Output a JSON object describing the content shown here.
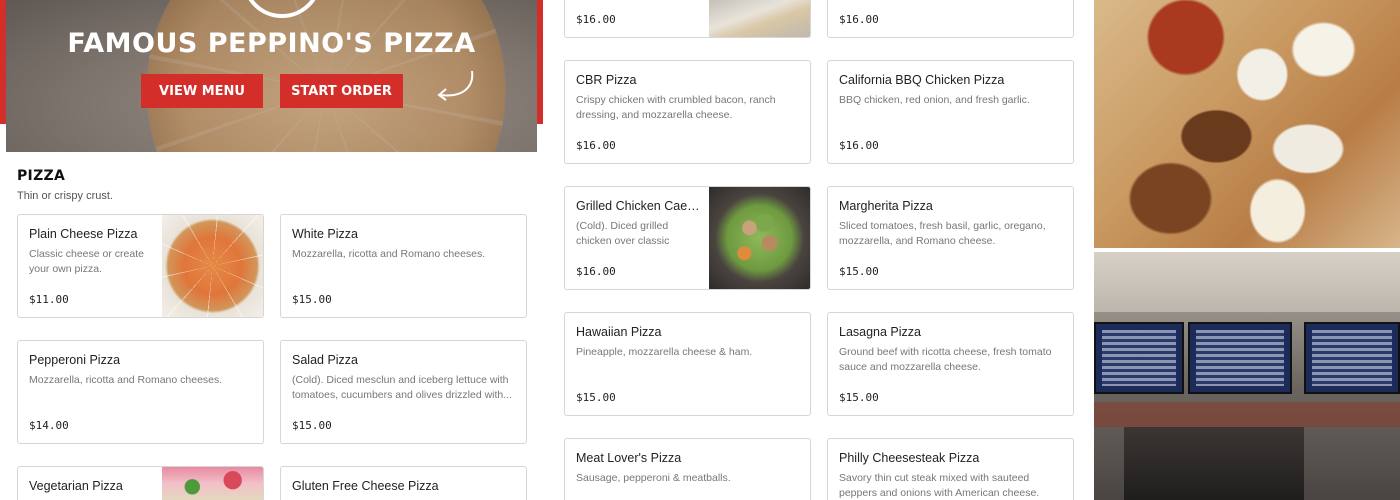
{
  "hero": {
    "title": "FAMOUS PEPPINO'S PIZZA",
    "view_menu_label": "VIEW MENU",
    "start_order_label": "START ORDER"
  },
  "section": {
    "title": "PIZZA",
    "subtitle": "Thin or crispy crust."
  },
  "menu": {
    "plain_cheese": {
      "name": "Plain Cheese Pizza",
      "desc": "Classic cheese or create your own pizza.",
      "price": "$11.00"
    },
    "white": {
      "name": "White Pizza",
      "desc": "Mozzarella, ricotta and Romano cheeses.",
      "price": "$15.00"
    },
    "pepperoni": {
      "name": "Pepperoni Pizza",
      "desc": "Mozzarella, ricotta and Romano cheeses.",
      "price": "$14.00"
    },
    "salad": {
      "name": "Salad Pizza",
      "desc": "(Cold). Diced mesclun and iceberg lettuce with tomatoes, cucumbers and olives drizzled with...",
      "price": "$15.00"
    },
    "vegetarian": {
      "name": "Vegetarian Pizza"
    },
    "gluten_free": {
      "name": "Gluten Free Cheese Pizza"
    },
    "top_left_partial": {
      "price": "$16.00"
    },
    "top_right_partial": {
      "price": "$16.00"
    },
    "cbr": {
      "name": "CBR Pizza",
      "desc": "Crispy chicken with crumbled bacon, ranch dressing, and mozzarella cheese.",
      "price": "$16.00"
    },
    "california_bbq": {
      "name": "California BBQ Chicken Pizza",
      "desc": "BBQ chicken, red onion, and fresh garlic.",
      "price": "$16.00"
    },
    "grilled_caesar": {
      "name": "Grilled Chicken Caesar Salad Pizza",
      "desc": "(Cold). Diced grilled chicken over classic Caesar salad.",
      "price": "$16.00"
    },
    "margherita": {
      "name": "Margherita Pizza",
      "desc": "Sliced tomatoes, fresh basil, garlic, oregano, mozzarella, and Romano cheese.",
      "price": "$15.00"
    },
    "hawaiian": {
      "name": "Hawaiian Pizza",
      "desc": "Pineapple, mozzarella cheese & ham.",
      "price": "$15.00"
    },
    "lasagna": {
      "name": "Lasagna Pizza",
      "desc": "Ground beef with ricotta cheese, fresh tomato sauce and mozzarella cheese.",
      "price": "$15.00"
    },
    "meat_lovers": {
      "name": "Meat Lover's Pizza",
      "desc": "Sausage, pepperoni & meatballs."
    },
    "philly": {
      "name": "Philly Cheesesteak Pizza",
      "desc": "Savory thin cut steak mixed with sauteed peppers and onions with American cheese."
    }
  },
  "colors": {
    "brand_red": "#d42e2b"
  },
  "icons": {
    "hero_arrow": "curved-arrow-icon"
  }
}
